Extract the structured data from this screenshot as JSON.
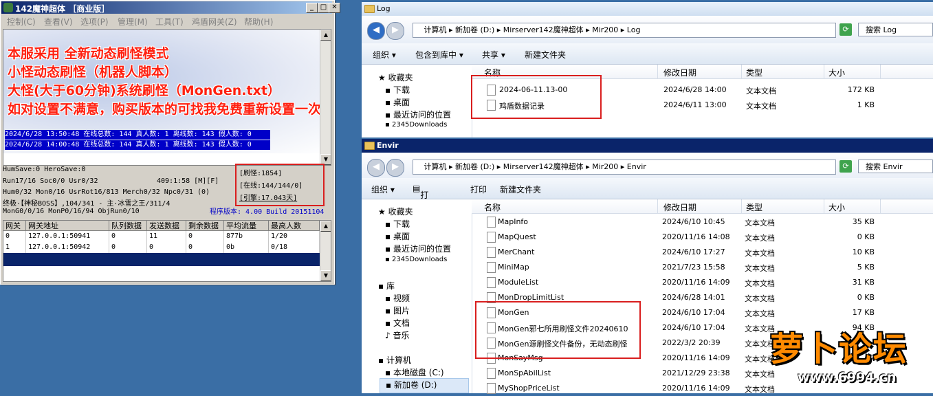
{
  "server_window": {
    "title": "142魔神超体 ［商业版］",
    "menu": [
      "控制(C)",
      "查看(V)",
      "选项(P)",
      "管理(M)",
      "工具(T)",
      "鸡盾网关(Z)",
      "帮助(H)"
    ],
    "promo_lines": [
      "本服采用 全新动态刷怪模式",
      "小怪动态刷怪（机器人脚本）",
      "大怪(大于60分钟)系统刷怪（MonGen.txt）",
      "如对设置不满意，购买版本的可找我免费重新设置一次"
    ],
    "log_lines": [
      "2024/6/28 13:50:48 在线总数: 144 真人数: 1 离线数: 143 假人数: 0",
      "2024/6/28 14:00:48 在线总数: 144 真人数: 1 离线数: 143 假人数: 0"
    ],
    "stats": [
      "HumSave:0 HeroSave:0",
      "Run17/16 Soc0/0 Usr0/32",
      "Hum0/32 Mon0/16 UsrRot16/813 Merch0/32 Npc0/31 (0)",
      "终极·【神秘BOSS】,104/341 - 主·冰雪之王/311/4",
      "MonG0/0/16 MonP0/16/94 ObjRun0/10"
    ],
    "clock": "409:1:58 [M][F]",
    "status_box": [
      "[刷怪:1854]",
      "[在线:144/144/0]",
      "[引擎:17.043天]"
    ],
    "version": "程序版本: 4.00 Build 20151104",
    "gateway_table": {
      "headers": [
        "网关",
        "网关地址",
        "队列数据",
        "发送数据",
        "剩余数据",
        "平均流量",
        "最高人数"
      ],
      "rows": [
        [
          "0",
          "127.0.0.1:50941",
          "0",
          "11",
          "0",
          "877b",
          "1/20"
        ],
        [
          "1",
          "127.0.0.1:50942",
          "0",
          "0",
          "0",
          "0b",
          "0/18"
        ]
      ]
    }
  },
  "explorer_log": {
    "title": "Log",
    "breadcrumb": [
      "计算机",
      "新加卷 (D:)",
      "Mirserver142魔神超体",
      "Mir200",
      "Log"
    ],
    "search_placeholder": "搜索 Log",
    "toolbar": [
      "组织 ▾",
      "包含到库中 ▾",
      "共享 ▾",
      "新建文件夹"
    ],
    "nav": [
      "收藏夹",
      "下载",
      "桌面",
      "最近访问的位置",
      "2345Downloads"
    ],
    "columns": [
      "名称",
      "修改日期",
      "类型",
      "大小"
    ],
    "files": [
      {
        "name": "2024-06-11.13-00",
        "date": "2024/6/28 14:00",
        "type": "文本文档",
        "size": "172 KB"
      },
      {
        "name": "鸡盾数据记录",
        "date": "2024/6/11 13:00",
        "type": "文本文档",
        "size": "1 KB"
      }
    ]
  },
  "explorer_envir": {
    "title": "Envir",
    "breadcrumb": [
      "计算机",
      "新加卷 (D:)",
      "Mirserver142魔神超体",
      "Mir200",
      "Envir"
    ],
    "search_placeholder": "搜索 Envir",
    "toolbar": [
      "组织 ▾",
      "打开 ▾",
      "打印",
      "新建文件夹"
    ],
    "nav": [
      "收藏夹",
      "下载",
      "桌面",
      "最近访问的位置",
      "2345Downloads",
      "库",
      "视频",
      "图片",
      "文档",
      "音乐",
      "计算机",
      "本地磁盘 (C:)",
      "新加卷 (D:)"
    ],
    "columns": [
      "名称",
      "修改日期",
      "类型",
      "大小"
    ],
    "files": [
      {
        "name": "MapInfo",
        "date": "2024/6/10 10:45",
        "type": "文本文档",
        "size": "35 KB"
      },
      {
        "name": "MapQuest",
        "date": "2020/11/16 14:08",
        "type": "文本文档",
        "size": "0 KB"
      },
      {
        "name": "MerChant",
        "date": "2024/6/10 17:27",
        "type": "文本文档",
        "size": "10 KB"
      },
      {
        "name": "MiniMap",
        "date": "2021/7/23 15:58",
        "type": "文本文档",
        "size": "5 KB"
      },
      {
        "name": "ModuleList",
        "date": "2020/11/16 14:09",
        "type": "文本文档",
        "size": "31 KB"
      },
      {
        "name": "MonDropLimitList",
        "date": "2024/6/28 14:01",
        "type": "文本文档",
        "size": "0 KB"
      },
      {
        "name": "MonGen",
        "date": "2024/6/10 17:04",
        "type": "文本文档",
        "size": "17 KB"
      },
      {
        "name": "MonGen邪七所用刷怪文件20240610",
        "date": "2024/6/10 17:04",
        "type": "文本文档",
        "size": "94 KB"
      },
      {
        "name": "MonGen源刷怪文件备份，无动态刷怪",
        "date": "2022/3/2 20:39",
        "type": "文本文档",
        "size": ""
      },
      {
        "name": "MonSayMsg",
        "date": "2020/11/16 14:09",
        "type": "文本文档",
        "size": ""
      },
      {
        "name": "MonSpAbilList",
        "date": "2021/12/29 23:38",
        "type": "文本文档",
        "size": ""
      },
      {
        "name": "MyShopPriceList",
        "date": "2020/11/16 14:09",
        "type": "文本文档",
        "size": ""
      }
    ]
  },
  "watermark": {
    "brand": "萝卜论坛",
    "url": "www.6994.cn"
  }
}
